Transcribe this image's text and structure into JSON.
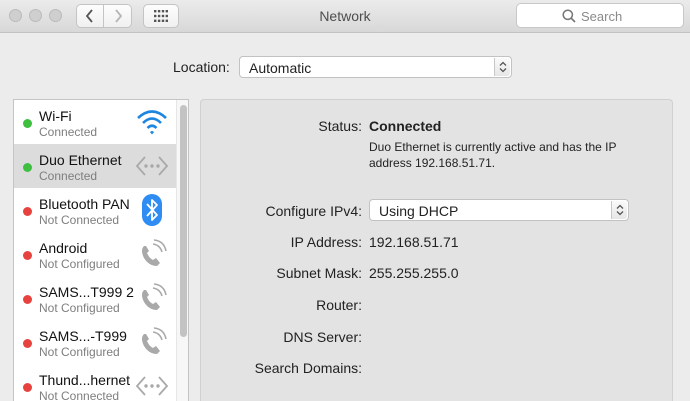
{
  "window": {
    "title": "Network"
  },
  "search": {
    "placeholder": "Search"
  },
  "location": {
    "label": "Location:",
    "value": "Automatic"
  },
  "services": [
    {
      "name": "Wi-Fi",
      "status": "Connected",
      "dot_color": "#3fbf3f",
      "icon": "wifi-icon"
    },
    {
      "name": "Duo Ethernet",
      "status": "Connected",
      "dot_color": "#3fbf3f",
      "icon": "ethernet-icon",
      "selected": true
    },
    {
      "name": "Bluetooth PAN",
      "status": "Not Connected",
      "dot_color": "#e8423f",
      "icon": "bluetooth-icon"
    },
    {
      "name": "Android",
      "status": "Not Configured",
      "dot_color": "#e8423f",
      "icon": "phone-icon"
    },
    {
      "name": "SAMS...T999 2",
      "status": "Not Configured",
      "dot_color": "#e8423f",
      "icon": "phone-icon"
    },
    {
      "name": "SAMS...-T999",
      "status": "Not Configured",
      "dot_color": "#e8423f",
      "icon": "phone-icon"
    },
    {
      "name": "Thund...hernet",
      "status": "Not Connected",
      "dot_color": "#e8423f",
      "icon": "ethernet-icon"
    }
  ],
  "detail": {
    "status_label": "Status:",
    "status_value": "Connected",
    "status_description": "Duo Ethernet is currently active and has the IP address 192.168.51.71.",
    "configure_label": "Configure IPv4:",
    "configure_value": "Using DHCP",
    "ip_label": "IP Address:",
    "ip_value": "192.168.51.71",
    "subnet_label": "Subnet Mask:",
    "subnet_value": "255.255.255.0",
    "router_label": "Router:",
    "dns_label": "DNS Server:",
    "domains_label": "Search Domains:"
  },
  "colors": {
    "connected": "#3fbf3f",
    "disconnected": "#e8423f",
    "bluetooth": "#2f8cf2",
    "wifi": "#1f86e0"
  }
}
